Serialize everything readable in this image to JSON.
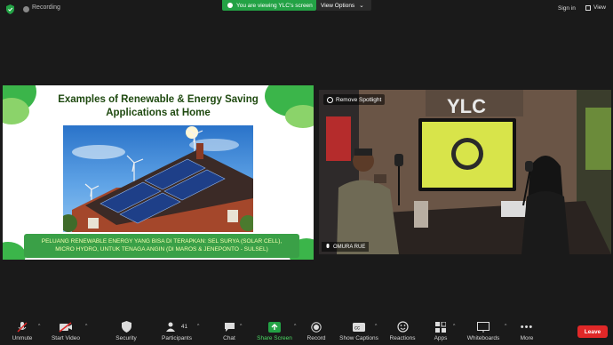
{
  "topbar": {
    "recording_label": "Recording",
    "viewing_label": "You are viewing YLC's screen",
    "view_options_label": "View Options",
    "signin_label": "Sign in",
    "view_label": "View"
  },
  "slide": {
    "title_line1": "Examples of Renewable & Energy Saving",
    "title_line2": "Applications at Home",
    "caption_line1": "PELUANG RENEWABLE ENERGY YANG BISA DI TERAPKAN: SEL SURYA (SOLAR CELL),",
    "caption_line2": "MICRO HYDRO, UNTUK TENAGA ANGIN (DI MAROS & JENEPONTO - SULSEL)",
    "colors": {
      "green": "#3bb54a",
      "light_green": "#8bd36a",
      "caption_bg": "#3aa047"
    }
  },
  "video": {
    "spotlight_label": "Remove Spotlight",
    "participant_name": "OMURA RUE",
    "sign_text": "YLC"
  },
  "toolbar": {
    "items": [
      {
        "label": "Unmute",
        "icon": "muted-mic-icon"
      },
      {
        "label": "Start Video",
        "icon": "video-off-icon"
      },
      {
        "label": "Security",
        "icon": "shield-icon"
      },
      {
        "label": "Participants",
        "icon": "participants-icon",
        "count": "41"
      },
      {
        "label": "Chat",
        "icon": "chat-icon"
      },
      {
        "label": "Share Screen",
        "icon": "share-screen-icon"
      },
      {
        "label": "Record",
        "icon": "record-icon"
      },
      {
        "label": "Show Captions",
        "icon": "captions-icon"
      },
      {
        "label": "Reactions",
        "icon": "reactions-icon"
      },
      {
        "label": "Apps",
        "icon": "apps-icon"
      },
      {
        "label": "Whiteboards",
        "icon": "whiteboard-icon"
      },
      {
        "label": "More",
        "icon": "more-icon"
      }
    ],
    "leave_label": "Leave",
    "leave_color": "#e02828",
    "share_color": "#23a245"
  }
}
